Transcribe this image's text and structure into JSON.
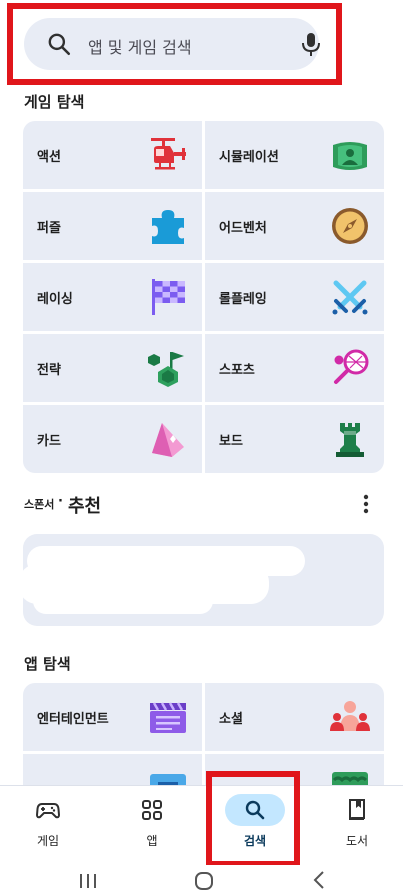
{
  "search": {
    "placeholder": "앱 및 게임 검색",
    "search_icon": "search-icon",
    "mic_icon": "microphone-icon"
  },
  "games_section": {
    "title": "게임 탐색",
    "tiles": [
      {
        "label": "액션",
        "icon": "helicopter-icon"
      },
      {
        "label": "시뮬레이션",
        "icon": "simulation-icon"
      },
      {
        "label": "퍼즐",
        "icon": "puzzle-piece-icon"
      },
      {
        "label": "어드벤처",
        "icon": "compass-icon"
      },
      {
        "label": "레이싱",
        "icon": "checkered-flag-icon"
      },
      {
        "label": "롤플레잉",
        "icon": "crossed-swords-icon"
      },
      {
        "label": "전략",
        "icon": "strategy-flag-icon"
      },
      {
        "label": "스포츠",
        "icon": "tennis-racket-icon"
      },
      {
        "label": "카드",
        "icon": "card-tent-icon"
      },
      {
        "label": "보드",
        "icon": "chess-rook-icon"
      }
    ]
  },
  "sponsored": {
    "small_label": "스폰서",
    "separator": "·",
    "title": "추천"
  },
  "apps_section": {
    "title": "앱 탐색",
    "tiles": [
      {
        "label": "엔터테인먼트",
        "icon": "clapperboard-icon"
      },
      {
        "label": "소셜",
        "icon": "people-icon"
      },
      {
        "label": "",
        "icon": "id-card-icon"
      },
      {
        "label": "",
        "icon": "green-app-icon"
      }
    ]
  },
  "bottom_nav": {
    "items": [
      {
        "label": "게임",
        "icon": "gamepad-icon",
        "active": false
      },
      {
        "label": "앱",
        "icon": "apps-grid-icon",
        "active": false
      },
      {
        "label": "검색",
        "icon": "search-icon",
        "active": true
      },
      {
        "label": "도서",
        "icon": "book-icon",
        "active": false
      }
    ]
  },
  "colors": {
    "tile_bg": "#e8ecf5",
    "highlight_red": "#e0161b",
    "active_pill": "#c3e7ff"
  }
}
